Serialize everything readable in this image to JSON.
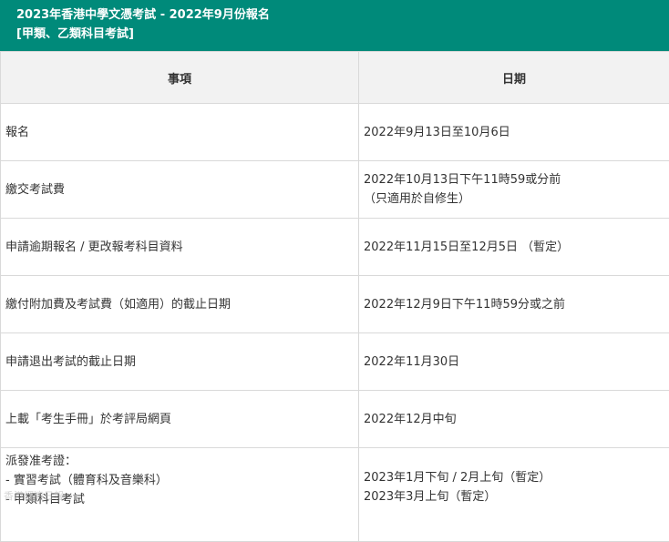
{
  "banner": {
    "title": "2023年香港中學文憑考試 - 2022年9月份報名",
    "subtitle": "[甲類、乙類科目考試]"
  },
  "table": {
    "headers": [
      "事項",
      "日期"
    ],
    "rows": [
      {
        "item": [
          "報名"
        ],
        "date": [
          "2022年9月13日至10月6日"
        ]
      },
      {
        "item": [
          "繳交考試費"
        ],
        "date": [
          "2022年10月13日下午11時59或分前",
          "（只適用於自修生）"
        ]
      },
      {
        "item": [
          "申請逾期報名 / 更改報考科目資料"
        ],
        "date": [
          "2022年11月15日至12月5日 （暫定）"
        ]
      },
      {
        "item": [
          "繳付附加費及考試費（如適用）的截止日期"
        ],
        "date": [
          "2022年12月9日下午11時59分或之前"
        ]
      },
      {
        "item": [
          "申請退出考試的截止日期"
        ],
        "date": [
          "2022年11月30日"
        ]
      },
      {
        "item": [
          "上載「考生手冊」於考評局網頁"
        ],
        "date": [
          "2022年12月中旬"
        ]
      },
      {
        "item": [
          "派發准考證：",
          "- 實習考試（體育科及音樂科）",
          "- 甲類科目考試"
        ],
        "date": [
          "2023年1月下旬 / 2月上旬（暫定）",
          "2023年3月上旬（暫定）"
        ]
      }
    ]
  },
  "watermark": "香港經濟日報"
}
